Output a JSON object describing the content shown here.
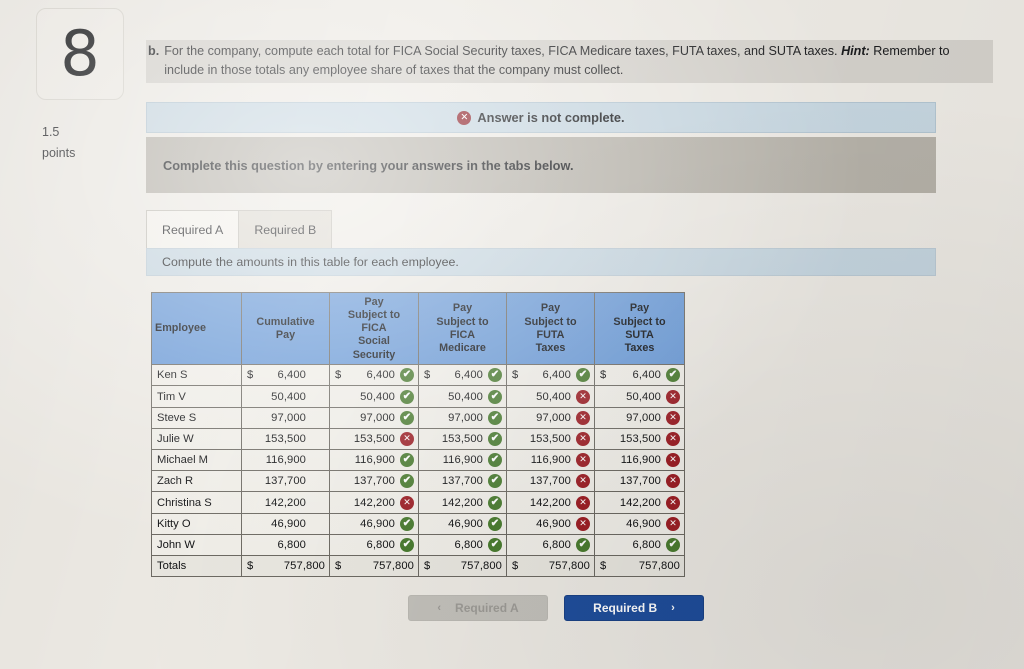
{
  "question": {
    "number": "8",
    "points_value": "1.5",
    "points_label": "points",
    "part_label": "b.",
    "prompt": "For the company, compute each total for FICA Social Security taxes, FICA Medicare taxes, FUTA taxes, and SUTA taxes.",
    "hint_label": "Hint:",
    "hint_text": "Remember to include in those totals any employee share of taxes that the company must collect."
  },
  "banners": {
    "alert_text": "Answer is not complete.",
    "alert_icon": "x-circle-icon",
    "instruction_text": "Complete this question by entering your answers in the tabs below.",
    "sub_instruction_text": "Compute the amounts in this table for each employee."
  },
  "tabs": [
    {
      "label": "Required A",
      "active": true
    },
    {
      "label": "Required B",
      "active": false
    }
  ],
  "table": {
    "headers": [
      "Employee",
      "Cumulative Pay",
      "Pay Subject to FICA Social Security",
      "Pay Subject to FICA Medicare",
      "Pay Subject to FUTA Taxes",
      "Pay Subject to SUTA Taxes"
    ],
    "header_lines": [
      [
        "Employee"
      ],
      [
        "Cumulative",
        "Pay"
      ],
      [
        "Pay",
        "Subject to",
        "FICA",
        "Social",
        "Security"
      ],
      [
        "Pay",
        "Subject to",
        "FICA",
        "Medicare"
      ],
      [
        "Pay",
        "Subject to",
        "FUTA",
        "Taxes"
      ],
      [
        "Pay",
        "Subject to",
        "SUTA",
        "Taxes"
      ]
    ],
    "currency_symbol": "$",
    "rows": [
      {
        "employee": "Ken S",
        "cumulative_pay": "6,400",
        "fica_ss": "6,400",
        "fica_ss_status": "correct",
        "fica_medicare": "6,400",
        "fica_medicare_status": "correct",
        "futa": "6,400",
        "futa_status": "correct",
        "suta": "6,400",
        "suta_status": "correct",
        "show_currency": true
      },
      {
        "employee": "Tim V",
        "cumulative_pay": "50,400",
        "fica_ss": "50,400",
        "fica_ss_status": "correct",
        "fica_medicare": "50,400",
        "fica_medicare_status": "correct",
        "futa": "50,400",
        "futa_status": "incorrect",
        "suta": "50,400",
        "suta_status": "incorrect",
        "show_currency": false
      },
      {
        "employee": "Steve S",
        "cumulative_pay": "97,000",
        "fica_ss": "97,000",
        "fica_ss_status": "correct",
        "fica_medicare": "97,000",
        "fica_medicare_status": "correct",
        "futa": "97,000",
        "futa_status": "incorrect",
        "suta": "97,000",
        "suta_status": "incorrect",
        "show_currency": false
      },
      {
        "employee": "Julie W",
        "cumulative_pay": "153,500",
        "fica_ss": "153,500",
        "fica_ss_status": "incorrect",
        "fica_medicare": "153,500",
        "fica_medicare_status": "correct",
        "futa": "153,500",
        "futa_status": "incorrect",
        "suta": "153,500",
        "suta_status": "incorrect",
        "show_currency": false
      },
      {
        "employee": "Michael M",
        "cumulative_pay": "116,900",
        "fica_ss": "116,900",
        "fica_ss_status": "correct",
        "fica_medicare": "116,900",
        "fica_medicare_status": "correct",
        "futa": "116,900",
        "futa_status": "incorrect",
        "suta": "116,900",
        "suta_status": "incorrect",
        "show_currency": false
      },
      {
        "employee": "Zach R",
        "cumulative_pay": "137,700",
        "fica_ss": "137,700",
        "fica_ss_status": "correct",
        "fica_medicare": "137,700",
        "fica_medicare_status": "correct",
        "futa": "137,700",
        "futa_status": "incorrect",
        "suta": "137,700",
        "suta_status": "incorrect",
        "show_currency": false
      },
      {
        "employee": "Christina S",
        "cumulative_pay": "142,200",
        "fica_ss": "142,200",
        "fica_ss_status": "incorrect",
        "fica_medicare": "142,200",
        "fica_medicare_status": "correct",
        "futa": "142,200",
        "futa_status": "incorrect",
        "suta": "142,200",
        "suta_status": "incorrect",
        "show_currency": false
      },
      {
        "employee": "Kitty O",
        "cumulative_pay": "46,900",
        "fica_ss": "46,900",
        "fica_ss_status": "correct",
        "fica_medicare": "46,900",
        "fica_medicare_status": "correct",
        "futa": "46,900",
        "futa_status": "incorrect",
        "suta": "46,900",
        "suta_status": "incorrect",
        "show_currency": false
      },
      {
        "employee": "John W",
        "cumulative_pay": "6,800",
        "fica_ss": "6,800",
        "fica_ss_status": "correct",
        "fica_medicare": "6,800",
        "fica_medicare_status": "correct",
        "futa": "6,800",
        "futa_status": "correct",
        "suta": "6,800",
        "suta_status": "correct",
        "show_currency": false
      }
    ],
    "totals": {
      "employee": "Totals",
      "cumulative_pay": "757,800",
      "fica_ss": "757,800",
      "fica_medicare": "757,800",
      "futa": "757,800",
      "suta": "757,800",
      "show_currency": true
    }
  },
  "footer": {
    "prev_button": {
      "label": "Required A",
      "icon": "chevron-left-icon",
      "disabled": true
    },
    "next_button": {
      "label": "Required B",
      "icon": "chevron-right-icon",
      "disabled": false
    }
  },
  "colors": {
    "page_background": "#edeae4",
    "table_header_blue": "#6b9bd8",
    "banner_blue": "#c6d6e0",
    "banner_gray": "#b6b2a9",
    "primary_button": "#1f4e9c",
    "correct_green": "#4a7c30",
    "incorrect_red": "#9d1f26",
    "alert_red": "#8c1d25"
  }
}
